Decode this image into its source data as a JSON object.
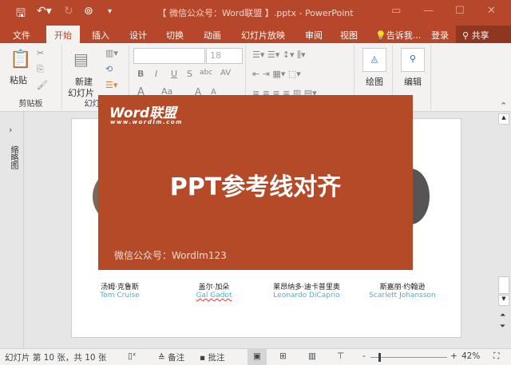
{
  "window": {
    "title": "【 微信公众号：Word联盟 】.pptx - PowerPoint"
  },
  "quick_access": {
    "save": "save-icon",
    "undo": "undo-icon",
    "redo": "redo-icon",
    "present": "present-icon",
    "customize": "▾"
  },
  "tabs": [
    {
      "label": "文件"
    },
    {
      "label": "开始",
      "active": true
    },
    {
      "label": "插入"
    },
    {
      "label": "设计"
    },
    {
      "label": "切换"
    },
    {
      "label": "动画"
    },
    {
      "label": "幻灯片放映"
    },
    {
      "label": "审阅"
    },
    {
      "label": "视图"
    },
    {
      "label": "告诉我..."
    },
    {
      "label": "登录"
    },
    {
      "label": "共享"
    }
  ],
  "ribbon": {
    "clipboard": {
      "paste": "粘贴",
      "label": "剪贴板"
    },
    "slides": {
      "new_slide_1": "新建",
      "new_slide_2": "幻灯片",
      "label": "幻灯片"
    },
    "font": {
      "name": "",
      "size": "18",
      "bold": "B",
      "italic": "I",
      "underline": "U",
      "strike": "S",
      "clear": "abc",
      "spacing": "AV",
      "color": "A",
      "case": "Aa",
      "grow": "A",
      "shrink": "A"
    },
    "drawing": {
      "label": "绘图"
    },
    "editing": {
      "label": "编辑"
    }
  },
  "thumbnails": {
    "label": "缩略图",
    "expand": "›"
  },
  "overlay": {
    "logo": "Word联盟",
    "logo_url": "www.wordlm.com",
    "title": "PPT参考线对齐",
    "footer": "微信公众号：Wordlm123",
    "color": "#b54a28"
  },
  "people": [
    {
      "cn": "汤姆·克鲁斯",
      "en": "Tom Cruise"
    },
    {
      "cn": "盖尔·加朵",
      "en": "Gal Gadot"
    },
    {
      "cn": "莱昂纳多·迪卡普里奥",
      "en": "Leonardo DiCaprio"
    },
    {
      "cn": "斯嘉丽·约翰逊",
      "en": "Scarlett Johansson"
    }
  ],
  "status": {
    "slide_info": "幻灯片 第 10 张，共 10 张",
    "notes": "备注",
    "comments": "批注",
    "zoom_minus": "-",
    "zoom_plus": "+",
    "zoom": "42%",
    "zoom_level_percent": 42
  },
  "colors": {
    "accent": "#b7472a",
    "name_en": "#3cb6d8"
  }
}
